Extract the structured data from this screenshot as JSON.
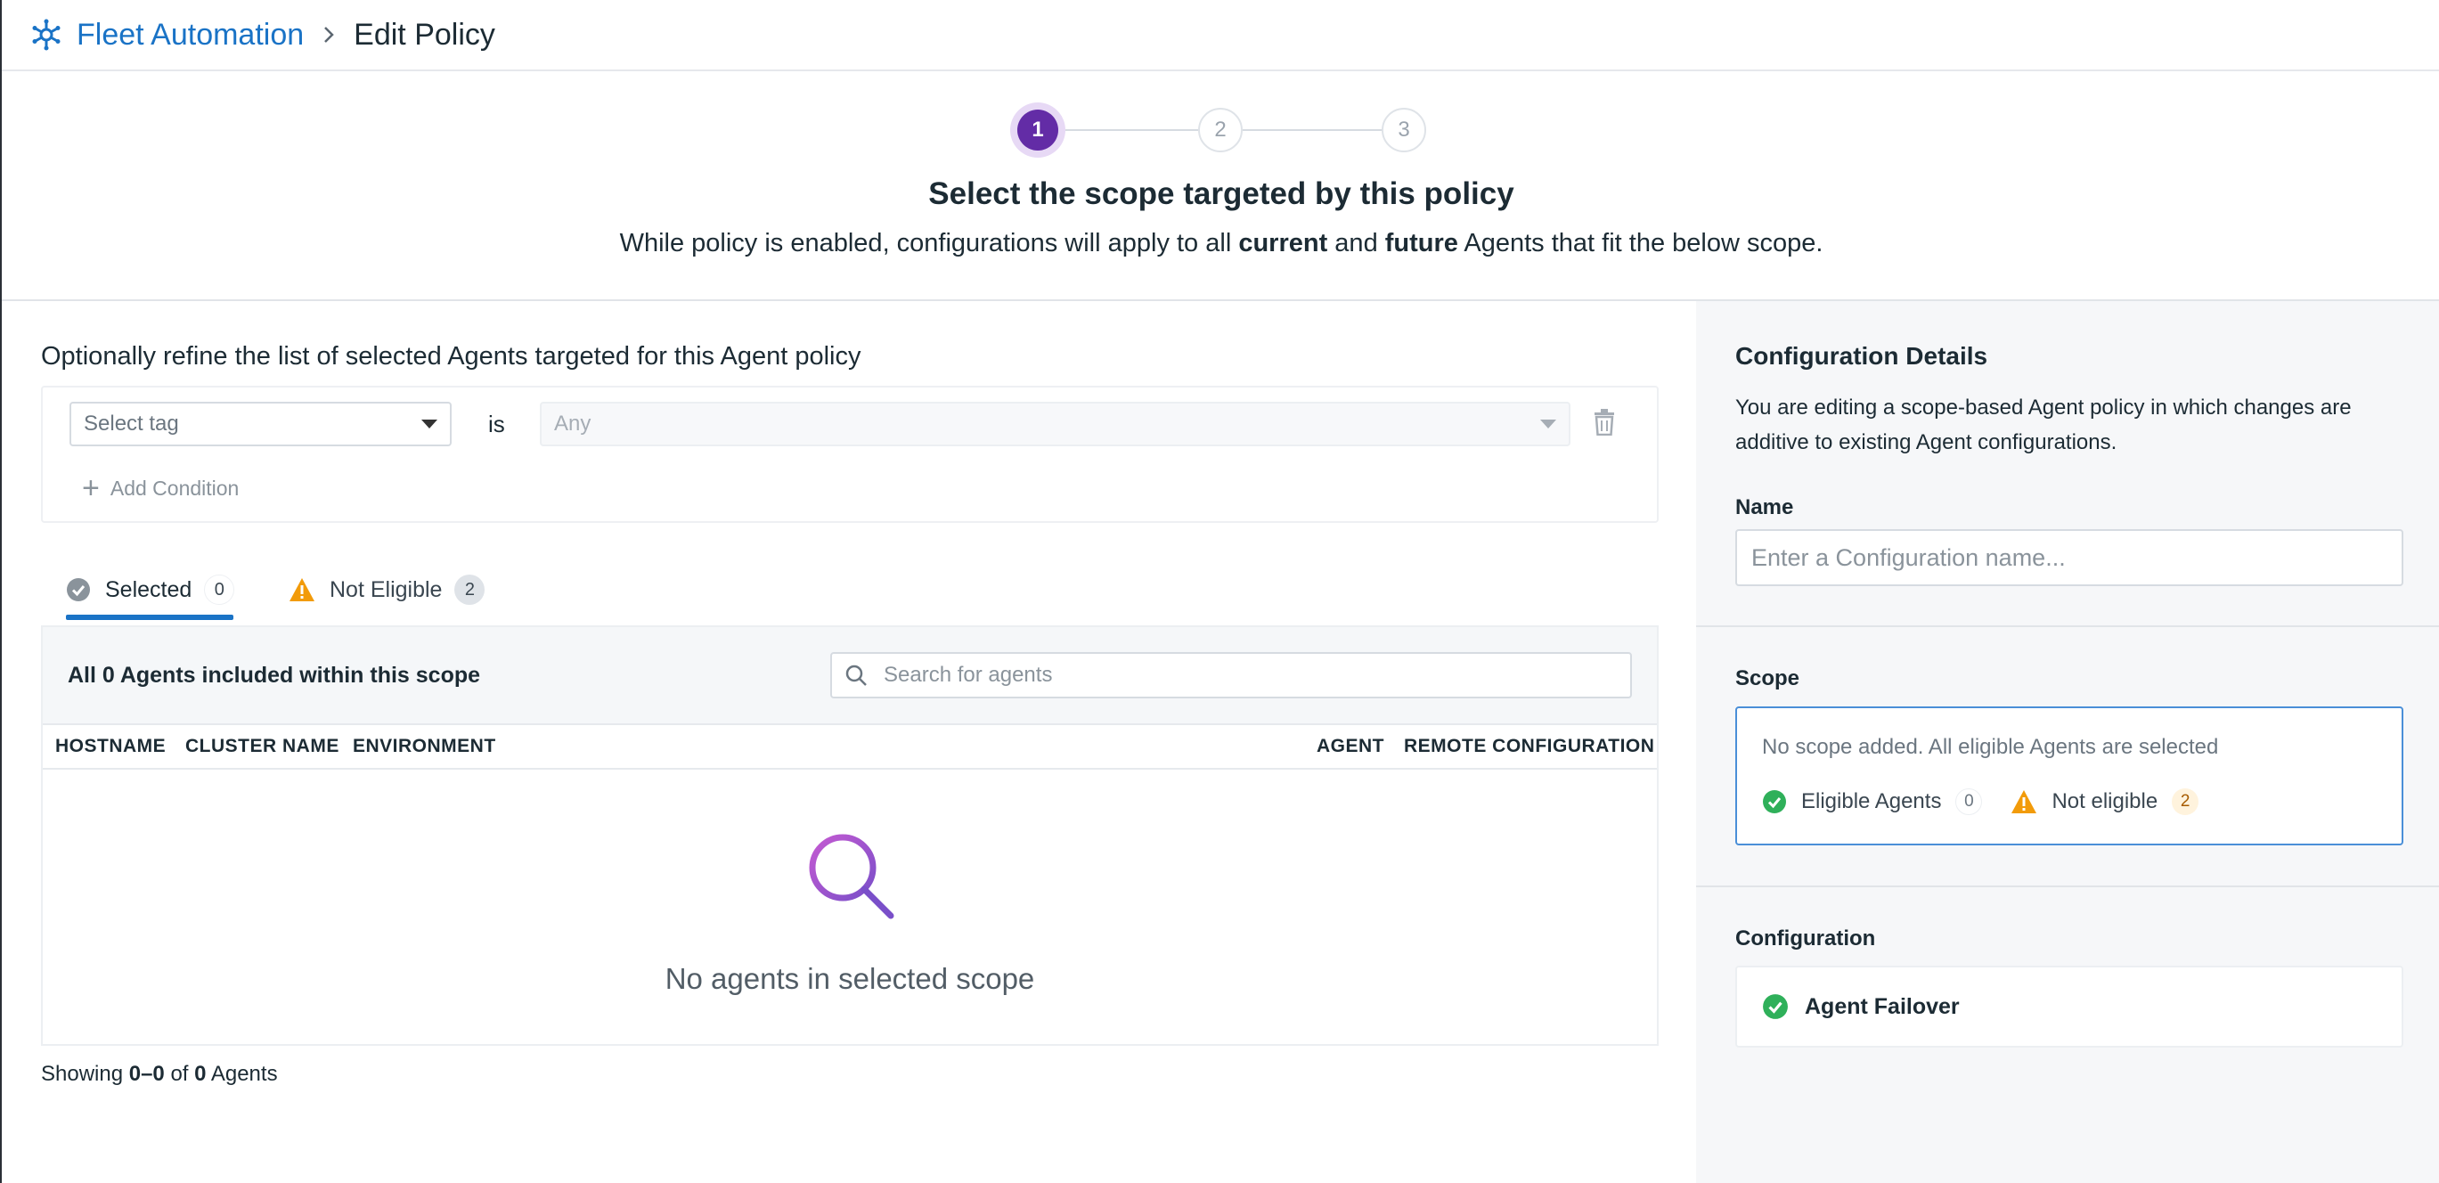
{
  "breadcrumb": {
    "parent": "Fleet Automation",
    "current": "Edit Policy"
  },
  "stepper": {
    "steps": [
      "1",
      "2",
      "3"
    ],
    "active": 1
  },
  "wizard": {
    "title": "Select the scope targeted by this policy",
    "subtitle_parts": [
      "While policy is enabled, configurations will apply to all ",
      "current",
      " and ",
      "future",
      " Agents that fit the below scope."
    ]
  },
  "refine": {
    "title": "Optionally refine the list of selected Agents targeted for this Agent policy",
    "tag_placeholder": "Select tag",
    "operator": "is",
    "value_placeholder": "Any",
    "add_condition": "Add Condition"
  },
  "tabs": [
    {
      "label": "Selected",
      "count": "0"
    },
    {
      "label": "Not Eligible",
      "count": "2"
    }
  ],
  "agents": {
    "summary_parts": [
      "All ",
      "0",
      " Agents included within this scope"
    ],
    "search_placeholder": "Search for agents",
    "columns": [
      "HOSTNAME",
      "CLUSTER NAME",
      "ENVIRONMENT",
      "AGENT",
      "REMOTE CONFIGURATION"
    ],
    "empty_message": "No agents in selected scope",
    "showing_parts": [
      "Showing ",
      "0–0",
      " of ",
      "0",
      " Agents"
    ]
  },
  "details": {
    "title": "Configuration Details",
    "description": "You are editing a scope-based Agent policy in which changes are additive to existing Agent configurations.",
    "name_label": "Name",
    "name_placeholder": "Enter a Configuration name...",
    "scope_label": "Scope",
    "scope_message": "No scope added. All eligible Agents are selected",
    "eligible_label": "Eligible Agents",
    "eligible_count": "0",
    "not_eligible_label": "Not eligible",
    "not_eligible_count": "2",
    "configuration_label": "Configuration",
    "configuration_item": "Agent Failover"
  },
  "colors": {
    "brand_purple": "#632ca6",
    "link_blue": "#1a73c6",
    "success_green": "#2fb05a",
    "warning_orange": "#f29b0a"
  }
}
